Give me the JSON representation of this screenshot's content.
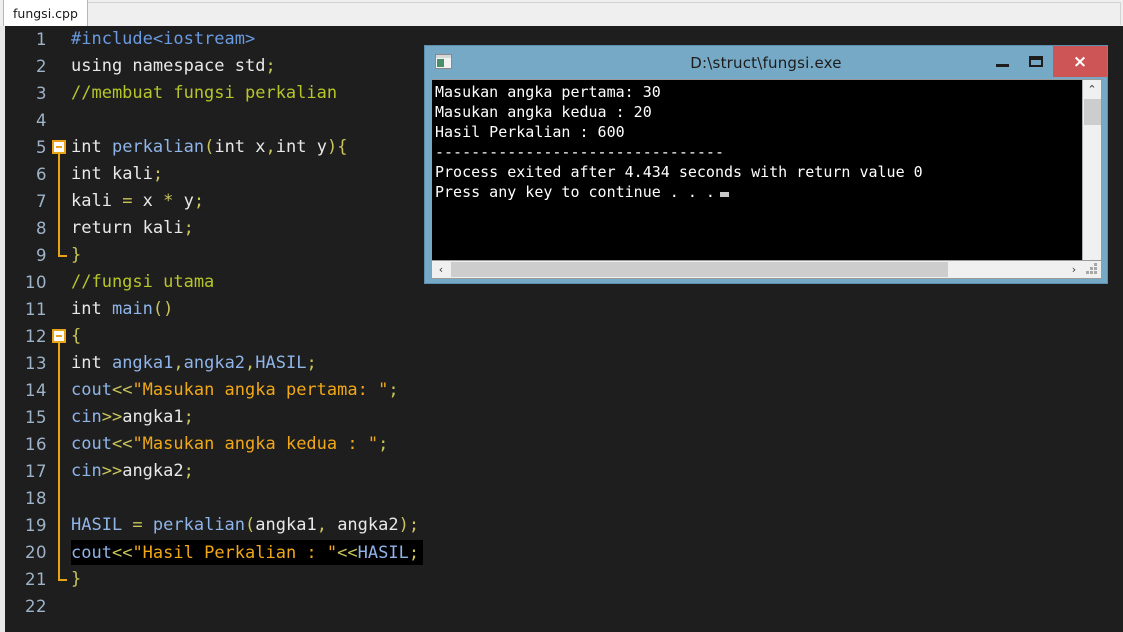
{
  "editor": {
    "tab_label": "fungsi.cpp",
    "lines": [
      {
        "n": "1",
        "fold": "none",
        "indent": false,
        "tokens": [
          {
            "t": "#include<iostream>",
            "c": "pp"
          }
        ]
      },
      {
        "n": "2",
        "fold": "none",
        "indent": false,
        "tokens": [
          {
            "t": "using namespace std",
            "c": "k"
          },
          {
            "t": ";",
            "c": "sc"
          }
        ]
      },
      {
        "n": "3",
        "fold": "none",
        "indent": false,
        "tokens": [
          {
            "t": "//membuat fungsi perkalian",
            "c": "cm"
          }
        ]
      },
      {
        "n": "4",
        "fold": "none",
        "indent": false,
        "tokens": [
          {
            "t": "",
            "c": "pl"
          }
        ]
      },
      {
        "n": "5",
        "fold": "box",
        "indent": false,
        "tokens": [
          {
            "t": "int ",
            "c": "k"
          },
          {
            "t": "perkalian",
            "c": "id"
          },
          {
            "t": "(",
            "c": "op"
          },
          {
            "t": "int ",
            "c": "k"
          },
          {
            "t": "x",
            "c": "pl"
          },
          {
            "t": ",",
            "c": "sc"
          },
          {
            "t": "int ",
            "c": "k"
          },
          {
            "t": "y",
            "c": "pl"
          },
          {
            "t": ")",
            "c": "op"
          },
          {
            "t": "{",
            "c": "op"
          }
        ]
      },
      {
        "n": "6",
        "fold": "line",
        "indent": false,
        "tokens": [
          {
            "t": "int ",
            "c": "k"
          },
          {
            "t": "kali",
            "c": "pl"
          },
          {
            "t": ";",
            "c": "sc"
          }
        ]
      },
      {
        "n": "7",
        "fold": "line",
        "indent": false,
        "tokens": [
          {
            "t": "kali ",
            "c": "pl"
          },
          {
            "t": "= ",
            "c": "op"
          },
          {
            "t": "x ",
            "c": "pl"
          },
          {
            "t": "* ",
            "c": "op"
          },
          {
            "t": "y",
            "c": "pl"
          },
          {
            "t": ";",
            "c": "sc"
          }
        ]
      },
      {
        "n": "8",
        "fold": "line",
        "indent": false,
        "tokens": [
          {
            "t": "return ",
            "c": "k"
          },
          {
            "t": "kali",
            "c": "pl"
          },
          {
            "t": ";",
            "c": "sc"
          }
        ]
      },
      {
        "n": "9",
        "fold": "end",
        "indent": false,
        "tokens": [
          {
            "t": "}",
            "c": "op"
          }
        ]
      },
      {
        "n": "10",
        "fold": "none",
        "indent": false,
        "tokens": [
          {
            "t": "//fungsi utama",
            "c": "cm"
          }
        ]
      },
      {
        "n": "11",
        "fold": "none",
        "indent": false,
        "tokens": [
          {
            "t": "int ",
            "c": "k"
          },
          {
            "t": "main",
            "c": "id"
          },
          {
            "t": "()",
            "c": "op"
          }
        ]
      },
      {
        "n": "12",
        "fold": "box",
        "indent": false,
        "tokens": [
          {
            "t": "{",
            "c": "op"
          }
        ]
      },
      {
        "n": "13",
        "fold": "line",
        "indent": false,
        "tokens": [
          {
            "t": "int ",
            "c": "k"
          },
          {
            "t": "angka1",
            "c": "id"
          },
          {
            "t": ",",
            "c": "sc"
          },
          {
            "t": "angka2",
            "c": "id"
          },
          {
            "t": ",",
            "c": "sc"
          },
          {
            "t": "HASIL",
            "c": "id"
          },
          {
            "t": ";",
            "c": "sc"
          }
        ]
      },
      {
        "n": "14",
        "fold": "line",
        "indent": false,
        "tokens": [
          {
            "t": "cout",
            "c": "id"
          },
          {
            "t": "<<",
            "c": "op"
          },
          {
            "t": "\"Masukan angka pertama: \"",
            "c": "st"
          },
          {
            "t": ";",
            "c": "sc"
          }
        ]
      },
      {
        "n": "15",
        "fold": "line",
        "indent": false,
        "tokens": [
          {
            "t": "cin",
            "c": "id"
          },
          {
            "t": ">>",
            "c": "op"
          },
          {
            "t": "angka1",
            "c": "pl"
          },
          {
            "t": ";",
            "c": "sc"
          }
        ]
      },
      {
        "n": "16",
        "fold": "line",
        "indent": false,
        "tokens": [
          {
            "t": "cout",
            "c": "id"
          },
          {
            "t": "<<",
            "c": "op"
          },
          {
            "t": "\"Masukan angka kedua : \"",
            "c": "st"
          },
          {
            "t": ";",
            "c": "sc"
          }
        ]
      },
      {
        "n": "17",
        "fold": "line",
        "indent": false,
        "tokens": [
          {
            "t": "cin",
            "c": "id"
          },
          {
            "t": ">>",
            "c": "op"
          },
          {
            "t": "angka2",
            "c": "pl"
          },
          {
            "t": ";",
            "c": "sc"
          }
        ]
      },
      {
        "n": "18",
        "fold": "line",
        "indent": false,
        "tokens": [
          {
            "t": "",
            "c": "pl"
          }
        ]
      },
      {
        "n": "19",
        "fold": "line",
        "indent": false,
        "tokens": [
          {
            "t": "HASIL ",
            "c": "id"
          },
          {
            "t": "= ",
            "c": "op"
          },
          {
            "t": "perkalian",
            "c": "id"
          },
          {
            "t": "(",
            "c": "op"
          },
          {
            "t": "angka1",
            "c": "pl"
          },
          {
            "t": ", ",
            "c": "sc"
          },
          {
            "t": "angka2",
            "c": "pl"
          },
          {
            "t": ")",
            "c": "op"
          },
          {
            "t": ";",
            "c": "sc"
          }
        ]
      },
      {
        "n": "20",
        "fold": "line",
        "indent": false,
        "highlight": true,
        "tokens": [
          {
            "t": "cout",
            "c": "id"
          },
          {
            "t": "<<",
            "c": "op"
          },
          {
            "t": "\"Hasil Perkalian : \"",
            "c": "st"
          },
          {
            "t": "<<",
            "c": "op"
          },
          {
            "t": "HASIL",
            "c": "id"
          },
          {
            "t": ";",
            "c": "sc"
          }
        ]
      },
      {
        "n": "21",
        "fold": "end",
        "indent": false,
        "tokens": [
          {
            "t": "}",
            "c": "op"
          }
        ]
      },
      {
        "n": "22",
        "fold": "none",
        "indent": false,
        "tokens": [
          {
            "t": "",
            "c": "pl"
          }
        ]
      }
    ]
  },
  "console": {
    "title": "D:\\struct\\fungsi.exe",
    "icon": "console-app-icon",
    "minimize_label": "",
    "maximize_label": "",
    "close_label": "×",
    "output_lines": [
      "Masukan angka pertama: 30",
      "Masukan angka kedua : 20",
      "Hasil Perkalian : 600",
      "--------------------------------",
      "Process exited after 4.434 seconds with return value 0",
      "Press any key to continue . . ."
    ],
    "scroll": {
      "up_arrow": "⌃",
      "down_arrow": "⌄",
      "left_arrow": "‹",
      "right_arrow": "›"
    }
  },
  "colors": {
    "title_bar": "#76a9c6",
    "close_button": "#cd5555",
    "editor_bg": "#1e1e1e",
    "console_bg": "#000000",
    "fold_marker": "#e8a317",
    "string": "#f0a818",
    "comment": "#b6c52a",
    "preprocessor": "#6a9ae0",
    "identifier": "#8fb4e8"
  }
}
